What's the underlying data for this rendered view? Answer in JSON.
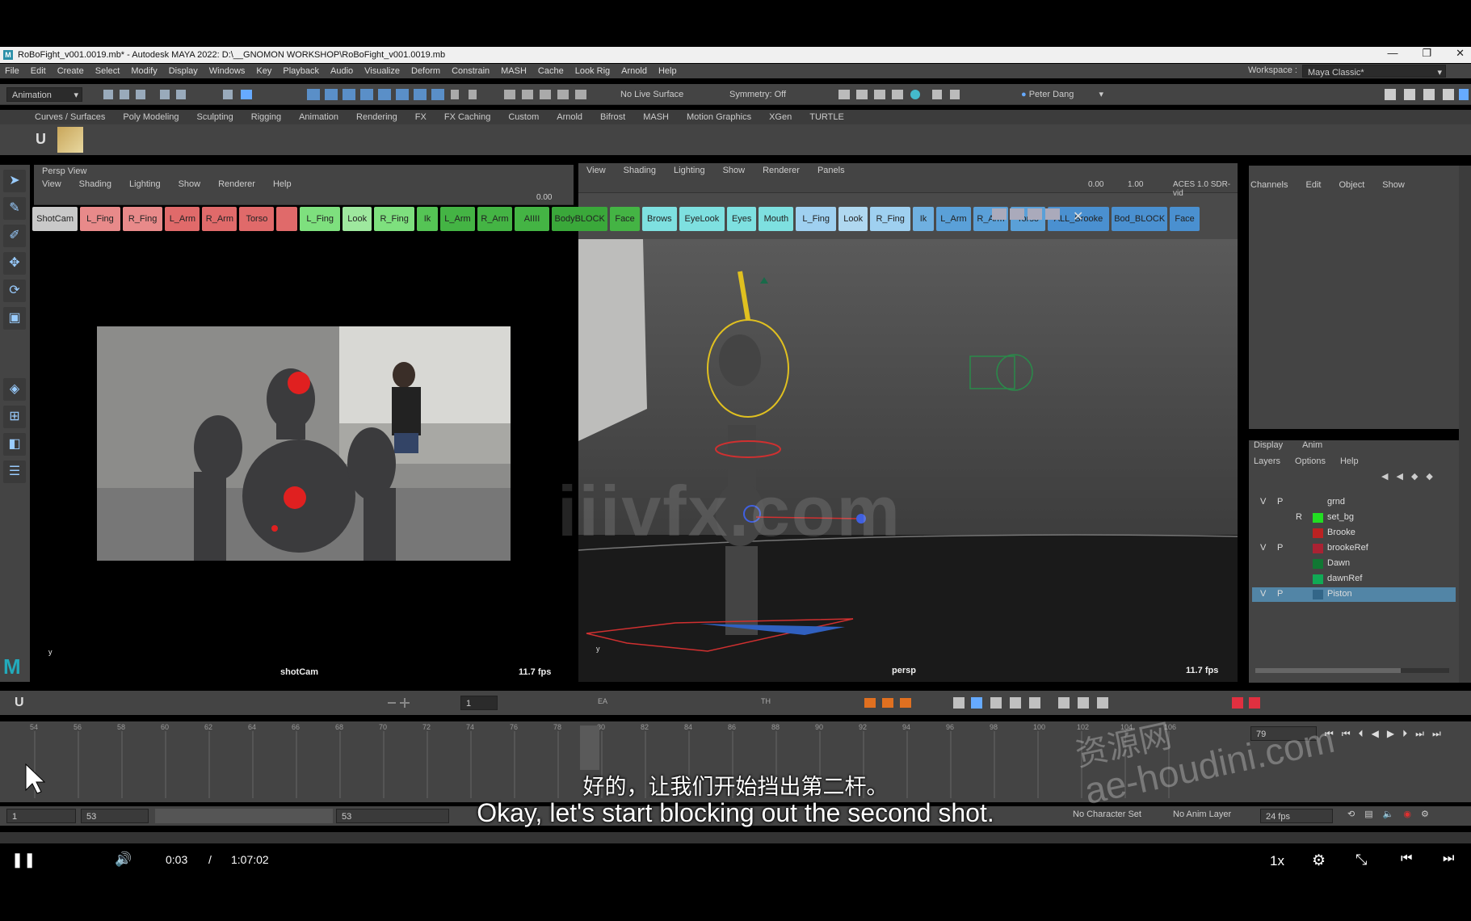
{
  "window": {
    "title": "RoBoFight_v001.0019.mb* - Autodesk MAYA 2022: D:\\__GNOMON WORKSHOP\\RoBoFight_v001.0019.mb",
    "controls": [
      "—",
      "❐",
      "✕"
    ]
  },
  "menu": [
    "File",
    "Edit",
    "Create",
    "Select",
    "Modify",
    "Display",
    "Windows",
    "Key",
    "Playback",
    "Audio",
    "Visualize",
    "Deform",
    "Constrain",
    "MASH",
    "Cache",
    "Look Rig",
    "Arnold",
    "Help"
  ],
  "workspace": {
    "label": "Workspace :",
    "value": "Maya Classic*"
  },
  "status": {
    "mode": "Animation",
    "live_surface": "No Live Surface",
    "symmetry": "Symmetry: Off",
    "user": "Peter Dang"
  },
  "shelf_tabs": [
    "Curves / Surfaces",
    "Poly Modeling",
    "Sculpting",
    "Rigging",
    "Animation",
    "Rendering",
    "FX",
    "FX Caching",
    "Custom",
    "Arnold",
    "Bifrost",
    "MASH",
    "Motion Graphics",
    "XGen",
    "TURTLE"
  ],
  "viewport_left": {
    "panel_name": "Persp View",
    "menu": [
      "View",
      "Shading",
      "Lighting",
      "Show",
      "Renderer",
      "Help"
    ],
    "value": "0.00",
    "camera": "shotCam",
    "fps": "11.7 fps"
  },
  "viewport_right": {
    "menu": [
      "View",
      "Shading",
      "Lighting",
      "Show",
      "Renderer",
      "Panels"
    ],
    "value1": "0.00",
    "value2": "1.00",
    "colorspace": "ACES 1.0 SDR-vid",
    "camera": "persp",
    "fps": "11.7 fps"
  },
  "selector_buttons": [
    {
      "label": "ShotCam",
      "color": "#c9c9c9"
    },
    {
      "label": "L_Fing",
      "color": "#e88a8a"
    },
    {
      "label": "R_Fing",
      "color": "#e88a8a"
    },
    {
      "label": "L_Arm",
      "color": "#e06a6a"
    },
    {
      "label": "R_Arm",
      "color": "#e06a6a"
    },
    {
      "label": "Torso",
      "color": "#e06a6a"
    },
    {
      "label": "",
      "color": "#e06a6a"
    },
    {
      "label": "L_Fing",
      "color": "#7ee07e"
    },
    {
      "label": "Look",
      "color": "#9ee89e"
    },
    {
      "label": "R_Fing",
      "color": "#7ee07e"
    },
    {
      "label": "Ik",
      "color": "#55c455"
    },
    {
      "label": "L_Arm",
      "color": "#44b444"
    },
    {
      "label": "R_Arm",
      "color": "#44b444"
    },
    {
      "label": "AIIII",
      "color": "#44b444"
    },
    {
      "label": "BodyBLOCK",
      "color": "#3aa83a"
    },
    {
      "label": "Face",
      "color": "#44b444"
    },
    {
      "label": "Brows",
      "color": "#7ee0e0"
    },
    {
      "label": "EyeLook",
      "color": "#7ee0e0"
    },
    {
      "label": "Eyes",
      "color": "#7ee0e0"
    },
    {
      "label": "Mouth",
      "color": "#7ee0e0"
    },
    {
      "label": "L_Fing",
      "color": "#9fd0f0"
    },
    {
      "label": "Look",
      "color": "#b0d8f0"
    },
    {
      "label": "R_Fing",
      "color": "#9fd0f0"
    },
    {
      "label": "Ik",
      "color": "#6fb0e0"
    },
    {
      "label": "L_Arm",
      "color": "#5aa0d8"
    },
    {
      "label": "R_Arm",
      "color": "#5aa0d8"
    },
    {
      "label": "Torso",
      "color": "#5aa0d8"
    },
    {
      "label": "ALL_Brooke",
      "color": "#4a90d0"
    },
    {
      "label": "Bod_BLOCK",
      "color": "#4a90d0"
    },
    {
      "label": "Face",
      "color": "#4a90d0"
    }
  ],
  "channel_box": {
    "menu": [
      "Channels",
      "Edit",
      "Object",
      "Show"
    ]
  },
  "layer_editor": {
    "tabs": [
      "Display",
      "Anim"
    ],
    "menu": [
      "Layers",
      "Options",
      "Help"
    ],
    "layers": [
      {
        "v": "V",
        "p": "P",
        "r": "",
        "name": "grnd",
        "color": "#444444"
      },
      {
        "v": "",
        "p": "",
        "r": "R",
        "name": "set_bg",
        "color": "#22dd22"
      },
      {
        "v": "",
        "p": "",
        "r": "",
        "name": "Brooke",
        "color": "#bb2222"
      },
      {
        "v": "V",
        "p": "P",
        "r": "",
        "name": "brookeRef",
        "color": "#aa2233"
      },
      {
        "v": "",
        "p": "",
        "r": "",
        "name": "Dawn",
        "color": "#117733"
      },
      {
        "v": "",
        "p": "",
        "r": "",
        "name": "dawnRef",
        "color": "#11aa55"
      },
      {
        "v": "V",
        "p": "P",
        "r": "",
        "name": "Piston",
        "color": "#336688"
      }
    ]
  },
  "timebar": {
    "frame": "1",
    "labels": [
      "EA",
      "TH"
    ]
  },
  "timeline": {
    "ticks": [
      "54",
      "56",
      "58",
      "60",
      "62",
      "64",
      "66",
      "68",
      "70",
      "72",
      "74",
      "76",
      "78",
      "80",
      "82",
      "84",
      "86",
      "88",
      "90",
      "92",
      "94",
      "96",
      "98",
      "100",
      "102",
      "104",
      "106"
    ],
    "current": "79"
  },
  "range": {
    "start": "1",
    "inner_start": "53",
    "inner_end": "53",
    "character_set": "No Character Set",
    "anim_layer": "No Anim Layer",
    "fps": "24 fps"
  },
  "subtitle": {
    "cn": "好的，让我们开始挡出第二杆。",
    "en": "Okay, let's start blocking out the second shot."
  },
  "watermark": {
    "main": "iiivfx.com",
    "cn_site": "资源网",
    "site": "ae-houdini.com"
  },
  "player": {
    "time": "0:03",
    "separator": "/",
    "duration": "1:07:02",
    "speed": "1x"
  },
  "colors": {
    "bg": "#444444",
    "selected": "#5285a6"
  }
}
